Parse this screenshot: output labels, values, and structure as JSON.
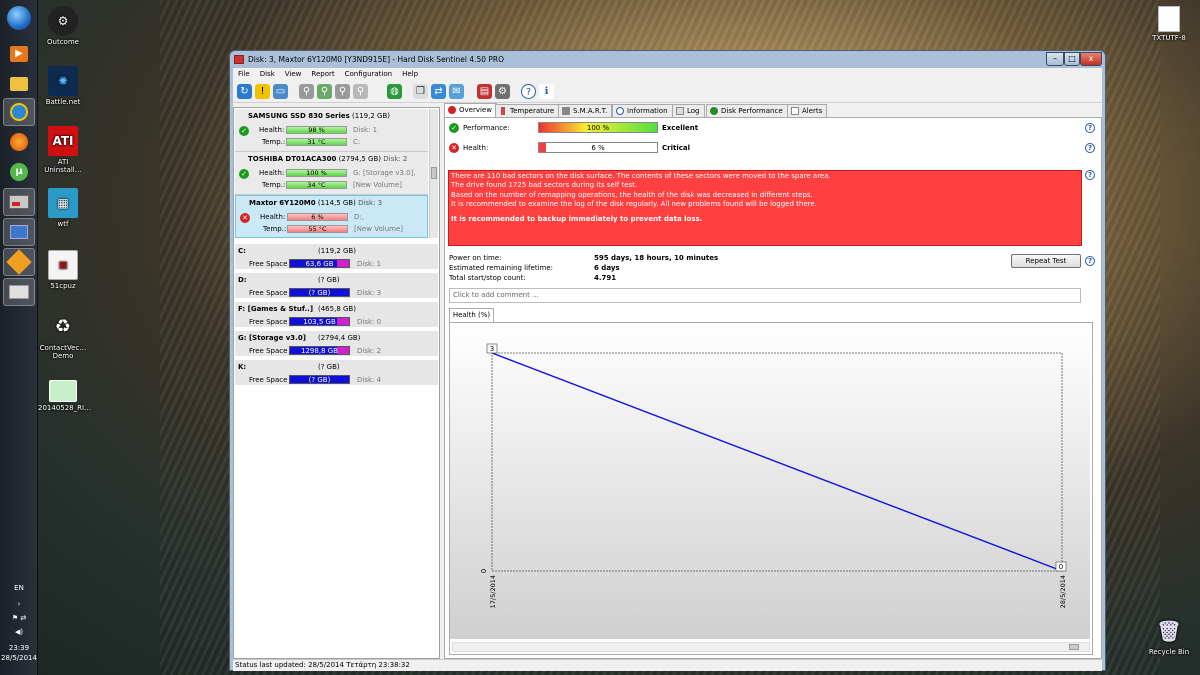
{
  "desktop": {
    "icons_left": [
      {
        "label": "Outcome"
      },
      {
        "label": "Battle.net"
      },
      {
        "label": "ATI Uninstall…"
      },
      {
        "label": "wtf"
      },
      {
        "label": "51cpuz"
      },
      {
        "label": "ContactVec… Demo"
      },
      {
        "label": "20140528_RI…"
      }
    ],
    "icons_right": [
      {
        "label": "TXTUTF-8"
      },
      {
        "label": "Recycle Bin"
      }
    ]
  },
  "taskbar": {
    "language": "EN",
    "time": "23:39",
    "date": "28/5/2014"
  },
  "window": {
    "title": "Disk: 3, Maxtor 6Y120M0 [Y3ND915E]  -  Hard Disk Sentinel 4.50 PRO",
    "controls": {
      "minimize": "–",
      "maximize": "□",
      "close": "x"
    },
    "menu": [
      "File",
      "Disk",
      "View",
      "Report",
      "Configuration",
      "Help"
    ],
    "status": "Status last updated: 28/5/2014 Τετάρτη 23:38:32"
  },
  "disks": [
    {
      "name": "SAMSUNG SSD 830 Series",
      "size": "(119,2 GB)",
      "disk": "Disk: 1",
      "health_label": "Health:",
      "health": "98 %",
      "health_pct": 98,
      "temp_label": "Temp.:",
      "temp": "31 °C",
      "vol_health": "Disk: 1",
      "vol_temp": "C:",
      "status": "ok"
    },
    {
      "name": "TOSHIBA DT01ACA300",
      "size": "(2794,5 GB)",
      "disk": "Disk: 2",
      "health_label": "Health:",
      "health": "100 %",
      "health_pct": 100,
      "temp_label": "Temp.:",
      "temp": "34 °C",
      "vol_health": "G: [Storage v3.0],",
      "vol_temp": "[New Volume]",
      "status": "ok"
    },
    {
      "name": "Maxtor 6Y120M0",
      "size": "(114,5 GB)",
      "disk": "Disk: 3",
      "health_label": "Health:",
      "health": "6 %",
      "health_pct": 6,
      "temp_label": "Temp.:",
      "temp": "55 °C",
      "vol_health": "D:,",
      "vol_temp": "[New Volume]",
      "status": "bad"
    }
  ],
  "partitions": [
    {
      "name": "C:",
      "size": "(119,2 GB)",
      "label": "Free Space",
      "free": "63,6 GB",
      "disk": "Disk: 1"
    },
    {
      "name": "D:",
      "size": "(? GB)",
      "label": "Free Space",
      "free": "(? GB)",
      "disk": "Disk: 3"
    },
    {
      "name": "F: [Games & Stuf..]",
      "size": "(465,8 GB)",
      "label": "Free Space",
      "free": "103,5 GB",
      "disk": "Disk: 0"
    },
    {
      "name": "G: [Storage v3.0]",
      "size": "(2794,4 GB)",
      "label": "Free Space",
      "free": "1298,8 GB",
      "disk": "Disk: 2"
    },
    {
      "name": "K:",
      "size": "(? GB)",
      "label": "Free Space",
      "free": "(? GB)",
      "disk": "Disk: 4"
    }
  ],
  "tabs": [
    "Overview",
    "Temperature",
    "S.M.A.R.T.",
    "Information",
    "Log",
    "Disk Performance",
    "Alerts"
  ],
  "overview": {
    "performance_label": "Performance:",
    "performance_value": "100 %",
    "performance_pct": 100,
    "performance_rating": "Excellent",
    "health_label": "Health:",
    "health_value": "6 %",
    "health_pct": 6,
    "health_rating": "Critical",
    "warning_lines": [
      "There are 110 bad sectors on the disk surface. The contents of these sectors were moved to the spare area.",
      "The drive found 1725 bad sectors during its self test.",
      "Based on the number of remapping operations, the health of the disk was decreased in different steps.",
      "It is recommended to examine the log of the disk regularly. All new problems found will be logged there."
    ],
    "warning_bold": "It is recommended to backup immediately to prevent data loss.",
    "power_on_label": "Power on time:",
    "power_on_value": "595 days, 18 hours, 10 minutes",
    "lifetime_label": "Estimated remaining lifetime:",
    "lifetime_value": "6 days",
    "startstop_label": "Total start/stop count:",
    "startstop_value": "4.791",
    "repeat_test": "Repeat Test",
    "comment_placeholder": "Click to add comment ..."
  },
  "chart_data": {
    "type": "line",
    "tab_label": "Health (%)",
    "x": [
      "17/5/2014",
      "28/5/2014"
    ],
    "series": [
      {
        "values": [
          3,
          0
        ]
      }
    ],
    "data_labels": [
      "3",
      "0"
    ],
    "y_tick_label": "0",
    "line_color": "#1010e0"
  }
}
